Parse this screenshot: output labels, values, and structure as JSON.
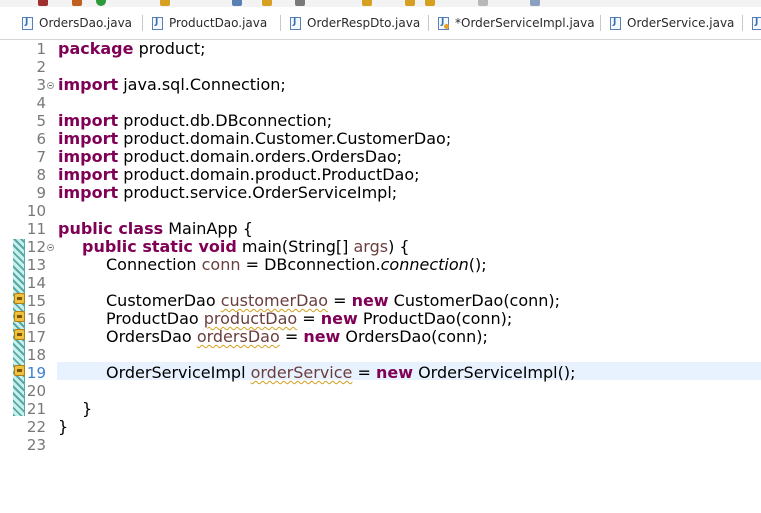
{
  "tabs": [
    {
      "label": "OrdersDao.java",
      "icon": "java-file-icon",
      "modified": false
    },
    {
      "label": "ProductDao.java",
      "icon": "java-file-icon",
      "modified": false
    },
    {
      "label": "OrderRespDto.java",
      "icon": "java-file-icon",
      "modified": false
    },
    {
      "label": "*OrderServiceImpl.java",
      "icon": "java-file-icon",
      "modified": true
    },
    {
      "label": "OrderService.java",
      "icon": "java-file-icon",
      "modified": false
    }
  ],
  "line_numbers": [
    "1",
    "2",
    "3",
    "4",
    "5",
    "6",
    "7",
    "8",
    "9",
    "10",
    "11",
    "12",
    "13",
    "14",
    "15",
    "16",
    "17",
    "18",
    "19",
    "20",
    "21",
    "22",
    "23"
  ],
  "code": {
    "l1_kw": "package",
    "l1_rest": " product;",
    "l3_kw": "import",
    "l3_rest": " java.sql.Connection;",
    "l5_kw": "import",
    "l5_rest": " product.db.DBconnection;",
    "l6_kw": "import",
    "l6_rest": " product.domain.Customer.CustomerDao;",
    "l7_kw": "import",
    "l7_rest": " product.domain.orders.OrdersDao;",
    "l8_kw": "import",
    "l8_rest": " product.domain.product.ProductDao;",
    "l9_kw": "import",
    "l9_rest": " product.service.OrderServiceImpl;",
    "l11_kw": "public class",
    "l11_rest": " MainApp {",
    "l12_kw": "public static void",
    "l12_a": " main(String[] ",
    "l12_param": "args",
    "l12_b": ") {",
    "l13_a": "Connection ",
    "l13_var": "conn",
    "l13_b": " = DBconnection.",
    "l13_call": "connection",
    "l13_c": "();",
    "l15_a": "CustomerDao ",
    "l15_var": "customerDao",
    "l15_b": " = ",
    "l15_kw": "new",
    "l15_c": " CustomerDao(conn);",
    "l16_a": "ProductDao ",
    "l16_var": "productDao",
    "l16_b": " = ",
    "l16_kw": "new",
    "l16_c": " ProductDao(conn);",
    "l17_a": "OrdersDao ",
    "l17_var": "ordersDao",
    "l17_b": " = ",
    "l17_kw": "new",
    "l17_c": " OrdersDao(conn);",
    "l19_a": "OrderServiceImpl ",
    "l19_var": "orderService",
    "l19_b": " = ",
    "l19_kw": "new",
    "l19_c": " OrderServiceImpl();",
    "l21": "}",
    "l22": "}"
  },
  "colors": {
    "keyword": "#7f0055",
    "local_variable": "#6a3e3e",
    "warning_underline": "#d4a020",
    "line_number": "#787878",
    "current_line": "#e8f2fe",
    "change_bar": "#58a8a4"
  }
}
